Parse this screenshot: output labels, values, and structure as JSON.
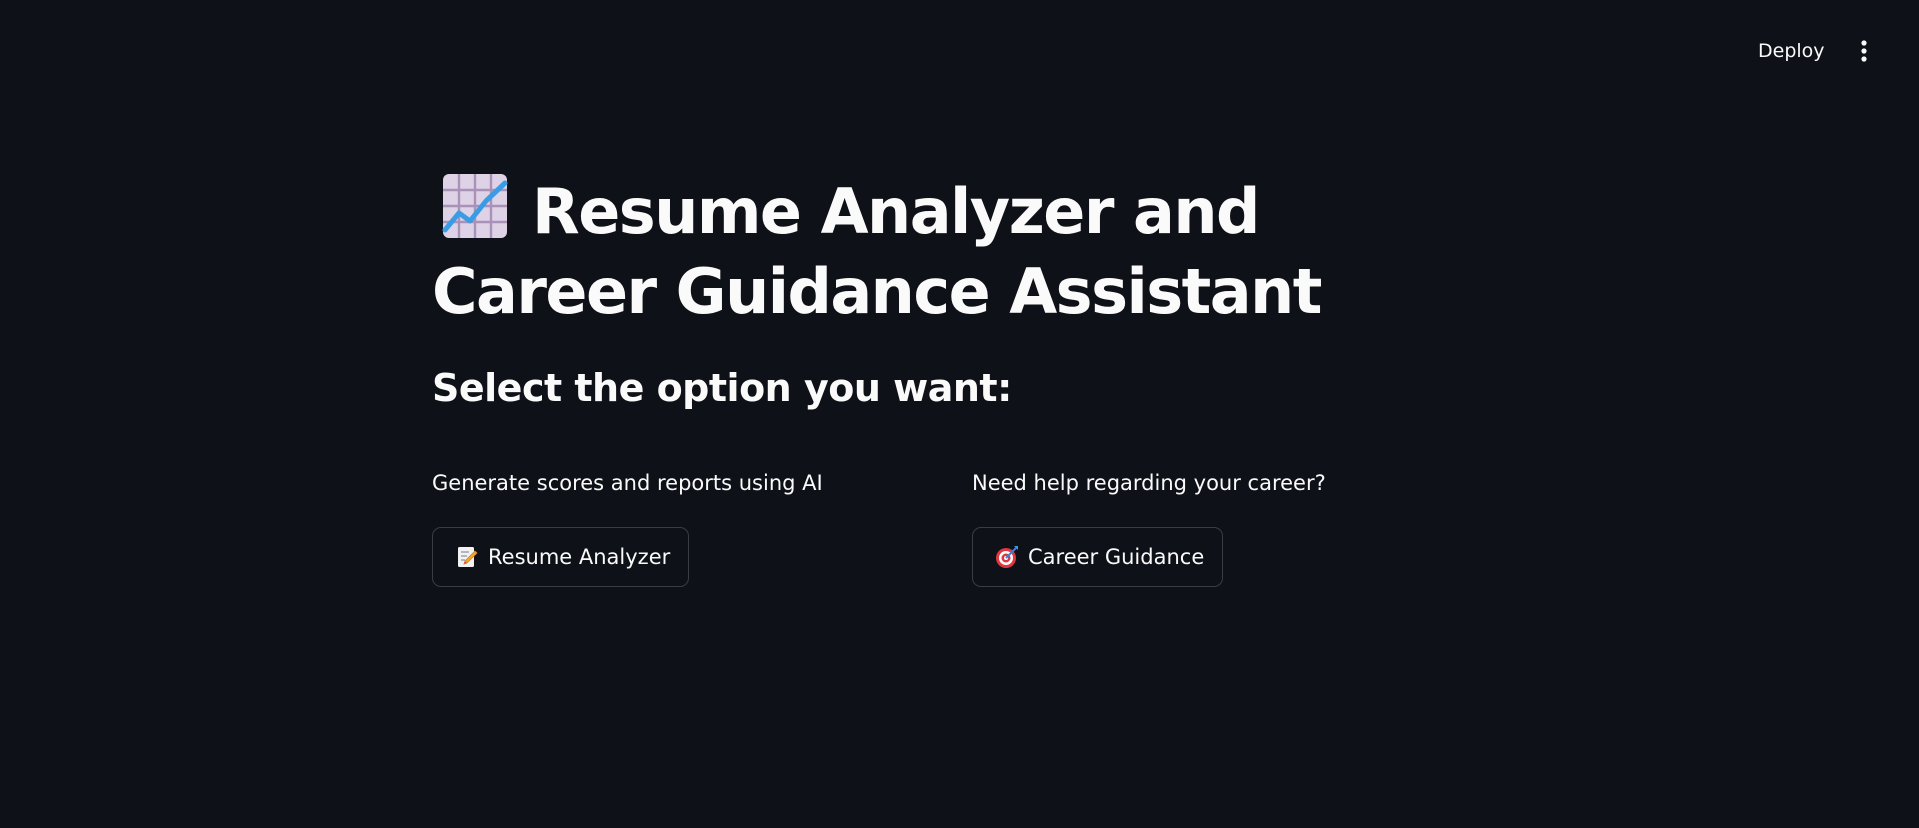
{
  "header": {
    "deploy_label": "Deploy",
    "menu_icon": "vertical-ellipsis-icon"
  },
  "main": {
    "title": "Resume Analyzer and Career Guidance Assistant",
    "title_icon": "chart-increasing-icon",
    "subtitle": "Select the option you want:",
    "options": [
      {
        "caption": "Generate scores and reports using AI",
        "button_label": "Resume Analyzer",
        "icon": "memo-icon"
      },
      {
        "caption": "Need help regarding your career?",
        "button_label": "Career Guidance",
        "icon": "direct-hit-icon"
      }
    ]
  },
  "colors": {
    "background": "#0e1117",
    "text": "#fafafa",
    "button_border": "#3a3d46"
  }
}
